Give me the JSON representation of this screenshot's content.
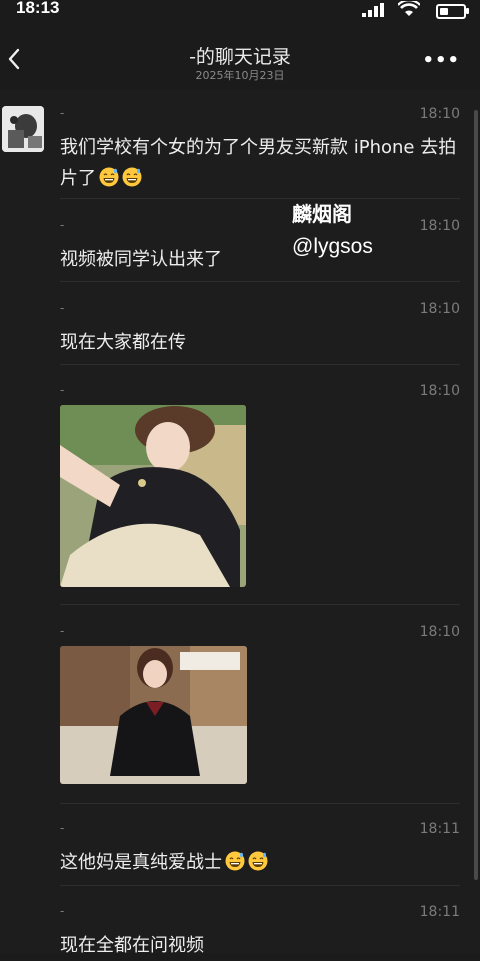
{
  "status_bar": {
    "time": "18:13"
  },
  "header": {
    "title": "-的聊天记录",
    "date": "2025年10月23日"
  },
  "watermark": {
    "line1": "麟烟阁",
    "line2": "@lygsos"
  },
  "messages": [
    {
      "sender": "-",
      "time": "18:10",
      "text": "我们学校有个女的为了个男友买新款 iPhone 去拍片了",
      "emojis": [
        "grinning-sweat-emoji",
        "grinning-sweat-emoji"
      ]
    },
    {
      "sender": "-",
      "time": "18:10",
      "text": "视频被同学认出来了"
    },
    {
      "sender": "-",
      "time": "18:10",
      "text": "现在大家都在传"
    },
    {
      "sender": "-",
      "time": "18:10",
      "image": "photo-girl-outdoor-hat"
    },
    {
      "sender": "-",
      "time": "18:10",
      "image": "photo-girl-sailor-uniform-indoor"
    },
    {
      "sender": "-",
      "time": "18:11",
      "text": "这他妈是真纯爱战士",
      "emojis": [
        "grinning-sweat-emoji",
        "grinning-sweat-emoji"
      ]
    },
    {
      "sender": "-",
      "time": "18:11",
      "text": "现在全都在问视频"
    }
  ],
  "colors": {
    "background": "#1b1b1b",
    "text": "#ededed",
    "muted": "#7b7b7b"
  }
}
